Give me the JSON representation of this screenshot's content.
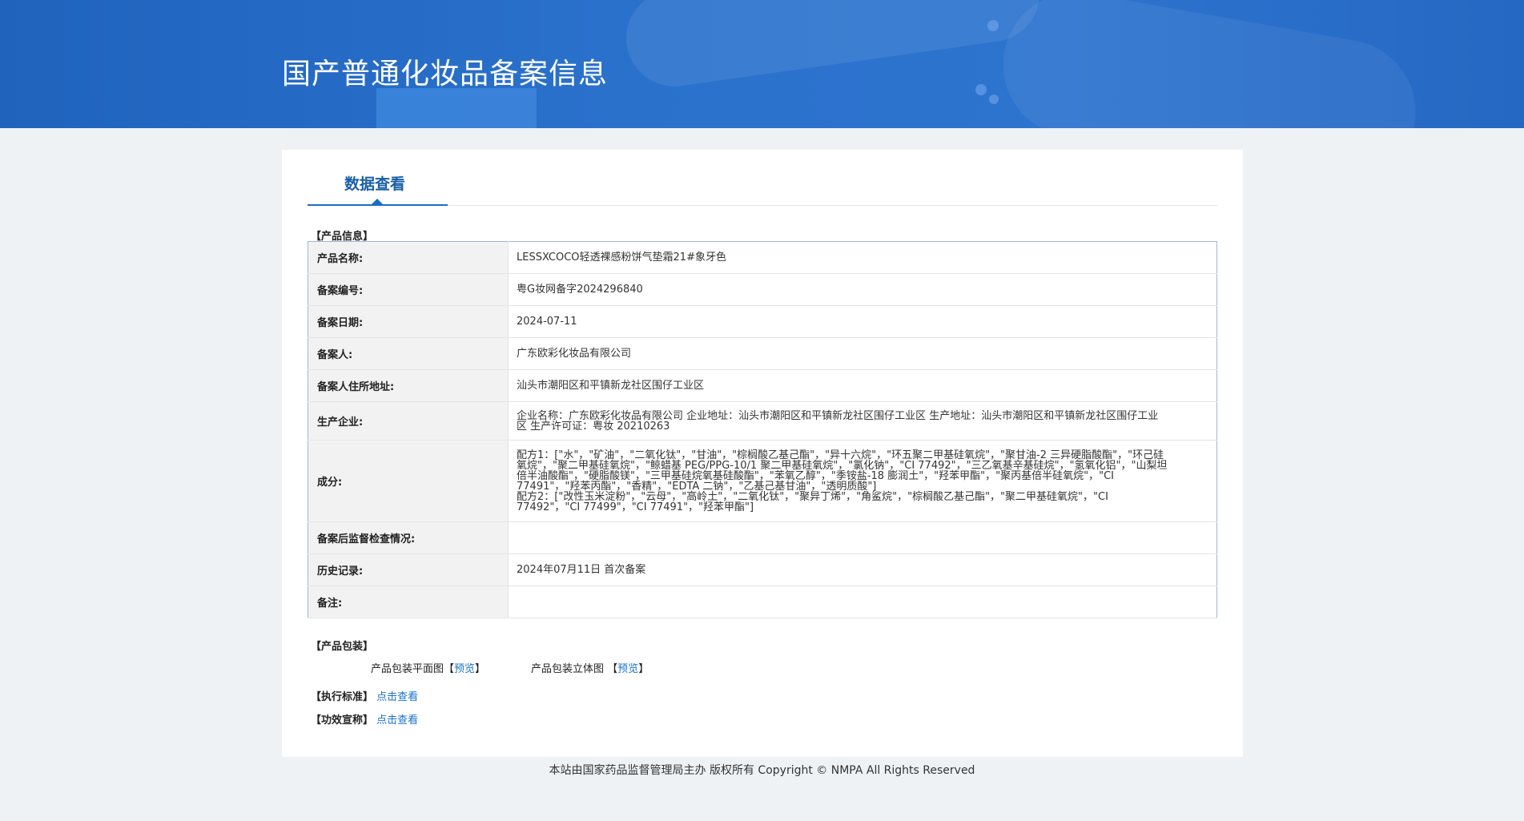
{
  "header": {
    "title": "国产普通化妆品备案信息"
  },
  "tabs": [
    {
      "label": "数据查看",
      "active": true
    }
  ],
  "product_info": {
    "section_label": "【产品信息】",
    "rows": [
      {
        "label": "产品名称:",
        "value": "LESSXCOCO轻透裸感粉饼气垫霜21#象牙色"
      },
      {
        "label": "备案编号:",
        "value": "粤G妆网备字2024296840"
      },
      {
        "label": "备案日期:",
        "value": "2024-07-11"
      },
      {
        "label": "备案人:",
        "value": "广东欧彩化妆品有限公司"
      },
      {
        "label": "备案人住所地址:",
        "value": "汕头市潮阳区和平镇新龙社区围仔工业区"
      },
      {
        "label": "生产企业:",
        "value": "企业名称：广东欧彩化妆品有限公司 企业地址：汕头市潮阳区和平镇新龙社区围仔工业区 生产地址：汕头市潮阳区和平镇新龙社区围仔工业区 生产许可证：粤妆 20210263"
      },
      {
        "label": "成分:",
        "value_line1": "配方1：[\"水\"，\"矿油\"，\"二氧化钛\"，\"甘油\"，\"棕榈酸乙基己酯\"，\"异十六烷\"，\"环五聚二甲基硅氧烷\"，\"聚甘油-2 三异硬脂酸酯\"，\"环己硅氧烷\"，\"聚二甲基硅氧烷\"，\"鲸蜡基 PEG/PPG-10/1 聚二甲基硅氧烷\"，\"氯化钠\"，\"CI 77492\"，\"三乙氧基辛基硅烷\"，\"氢氧化铝\"，\"山梨坦倍半油酸酯\"，\"硬脂酸镁\"，\"三甲基硅烷氧基硅酸酯\"，\"苯氧乙醇\"，\"季铵盐-18 膨润土\"，\"羟苯甲酯\"，\"聚丙基倍半硅氧烷\"，\"CI 77491\"，\"羟苯丙酯\"，\"香精\"，\"EDTA 二钠\"，\"乙基己基甘油\"，\"透明质酸\"]",
        "value_line2": "配方2：[\"改性玉米淀粉\"，\"云母\"，\"高岭土\"，\"二氧化钛\"，\"聚异丁烯\"，\"角鲨烷\"，\"棕榈酸乙基己酯\"，\"聚二甲基硅氧烷\"，\"CI 77492\"，\"CI 77499\"，\"CI 77491\"，\"羟苯甲酯\"]"
      },
      {
        "label": "备案后监督检查情况:",
        "value": ""
      },
      {
        "label": "历史记录:",
        "value": "2024年07月11日 首次备案"
      },
      {
        "label": "备注:",
        "value": ""
      }
    ]
  },
  "packaging": {
    "section_label": "【产品包装】",
    "flat_label": "产品包装平面图",
    "solid_label": "产品包装立体图",
    "bracket_open": "【",
    "bracket_close": "】",
    "preview_label": "预览"
  },
  "standard": {
    "label": "【执行标准】",
    "link": "点击查看"
  },
  "efficacy": {
    "label": "【功效宣称】",
    "link": "点击查看"
  },
  "footer": {
    "text": "本站由国家药品监督管理局主办 版权所有 Copyright © NMPA All Rights Reserved"
  }
}
